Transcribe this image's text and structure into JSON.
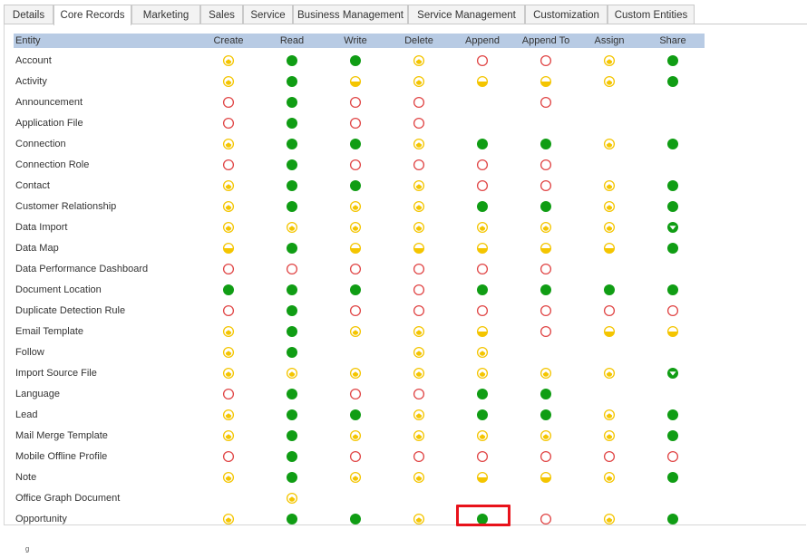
{
  "tabs": [
    "Details",
    "Core Records",
    "Marketing",
    "Sales",
    "Service",
    "Business Management",
    "Service Management",
    "Customization",
    "Custom Entities"
  ],
  "active_tab": "Core Records",
  "grid": {
    "headers": {
      "entity": "Entity",
      "columns": [
        "Create",
        "Read",
        "Write",
        "Delete",
        "Append",
        "Append To",
        "Assign",
        "Share"
      ]
    },
    "legend": {
      "N": "none-icon",
      "U": "user-level-icon",
      "B": "business-unit-level-icon",
      "P": "parent-child-level-icon",
      "O": "organization-level-icon"
    },
    "colors": {
      "none": "#e04545",
      "user": "#f4c500",
      "organization": "#109d14"
    },
    "rows": [
      {
        "entity": "Account",
        "levels": [
          "U",
          "O",
          "O",
          "U",
          "N",
          "N",
          "U",
          "O"
        ]
      },
      {
        "entity": "Activity",
        "levels": [
          "U",
          "O",
          "B",
          "U",
          "B",
          "B",
          "U",
          "O"
        ]
      },
      {
        "entity": "Announcement",
        "levels": [
          "N",
          "O",
          "N",
          "N",
          "",
          "N",
          "",
          ""
        ]
      },
      {
        "entity": "Application File",
        "levels": [
          "N",
          "O",
          "N",
          "N",
          "",
          "",
          "",
          ""
        ]
      },
      {
        "entity": "Connection",
        "levels": [
          "U",
          "O",
          "O",
          "U",
          "O",
          "O",
          "U",
          "O"
        ]
      },
      {
        "entity": "Connection Role",
        "levels": [
          "N",
          "O",
          "N",
          "N",
          "N",
          "N",
          "",
          ""
        ]
      },
      {
        "entity": "Contact",
        "levels": [
          "U",
          "O",
          "O",
          "U",
          "N",
          "N",
          "U",
          "O"
        ]
      },
      {
        "entity": "Customer Relationship",
        "levels": [
          "U",
          "O",
          "U",
          "U",
          "O",
          "O",
          "U",
          "O"
        ]
      },
      {
        "entity": "Data Import",
        "levels": [
          "U",
          "U",
          "U",
          "U",
          "U",
          "U",
          "U",
          "P"
        ]
      },
      {
        "entity": "Data Map",
        "levels": [
          "B",
          "O",
          "B",
          "B",
          "B",
          "B",
          "B",
          "O"
        ]
      },
      {
        "entity": "Data Performance Dashboard",
        "levels": [
          "N",
          "N",
          "N",
          "N",
          "N",
          "N",
          "",
          ""
        ]
      },
      {
        "entity": "Document Location",
        "levels": [
          "O",
          "O",
          "O",
          "N",
          "O",
          "O",
          "O",
          "O"
        ]
      },
      {
        "entity": "Duplicate Detection Rule",
        "levels": [
          "N",
          "O",
          "N",
          "N",
          "N",
          "N",
          "N",
          "N"
        ]
      },
      {
        "entity": "Email Template",
        "levels": [
          "U",
          "O",
          "U",
          "U",
          "B",
          "N",
          "B",
          "B"
        ]
      },
      {
        "entity": "Follow",
        "levels": [
          "U",
          "O",
          "",
          "U",
          "U",
          "",
          "",
          ""
        ]
      },
      {
        "entity": "Import Source File",
        "levels": [
          "U",
          "U",
          "U",
          "U",
          "U",
          "U",
          "U",
          "P"
        ]
      },
      {
        "entity": "Language",
        "levels": [
          "N",
          "O",
          "N",
          "N",
          "O",
          "O",
          "",
          ""
        ]
      },
      {
        "entity": "Lead",
        "levels": [
          "U",
          "O",
          "O",
          "U",
          "O",
          "O",
          "U",
          "O"
        ]
      },
      {
        "entity": "Mail Merge Template",
        "levels": [
          "U",
          "O",
          "U",
          "U",
          "U",
          "U",
          "U",
          "O"
        ]
      },
      {
        "entity": "Mobile Offline Profile",
        "levels": [
          "N",
          "O",
          "N",
          "N",
          "N",
          "N",
          "N",
          "N"
        ]
      },
      {
        "entity": "Note",
        "levels": [
          "U",
          "O",
          "U",
          "U",
          "B",
          "B",
          "U",
          "O"
        ]
      },
      {
        "entity": "Office Graph Document",
        "levels": [
          "",
          "U",
          "",
          "",
          "",
          "",
          "",
          ""
        ]
      },
      {
        "entity": "Opportunity",
        "levels": [
          "U",
          "O",
          "O",
          "U",
          "O",
          "N",
          "U",
          "O"
        ]
      }
    ]
  },
  "footer_glyph": "ᵍ"
}
